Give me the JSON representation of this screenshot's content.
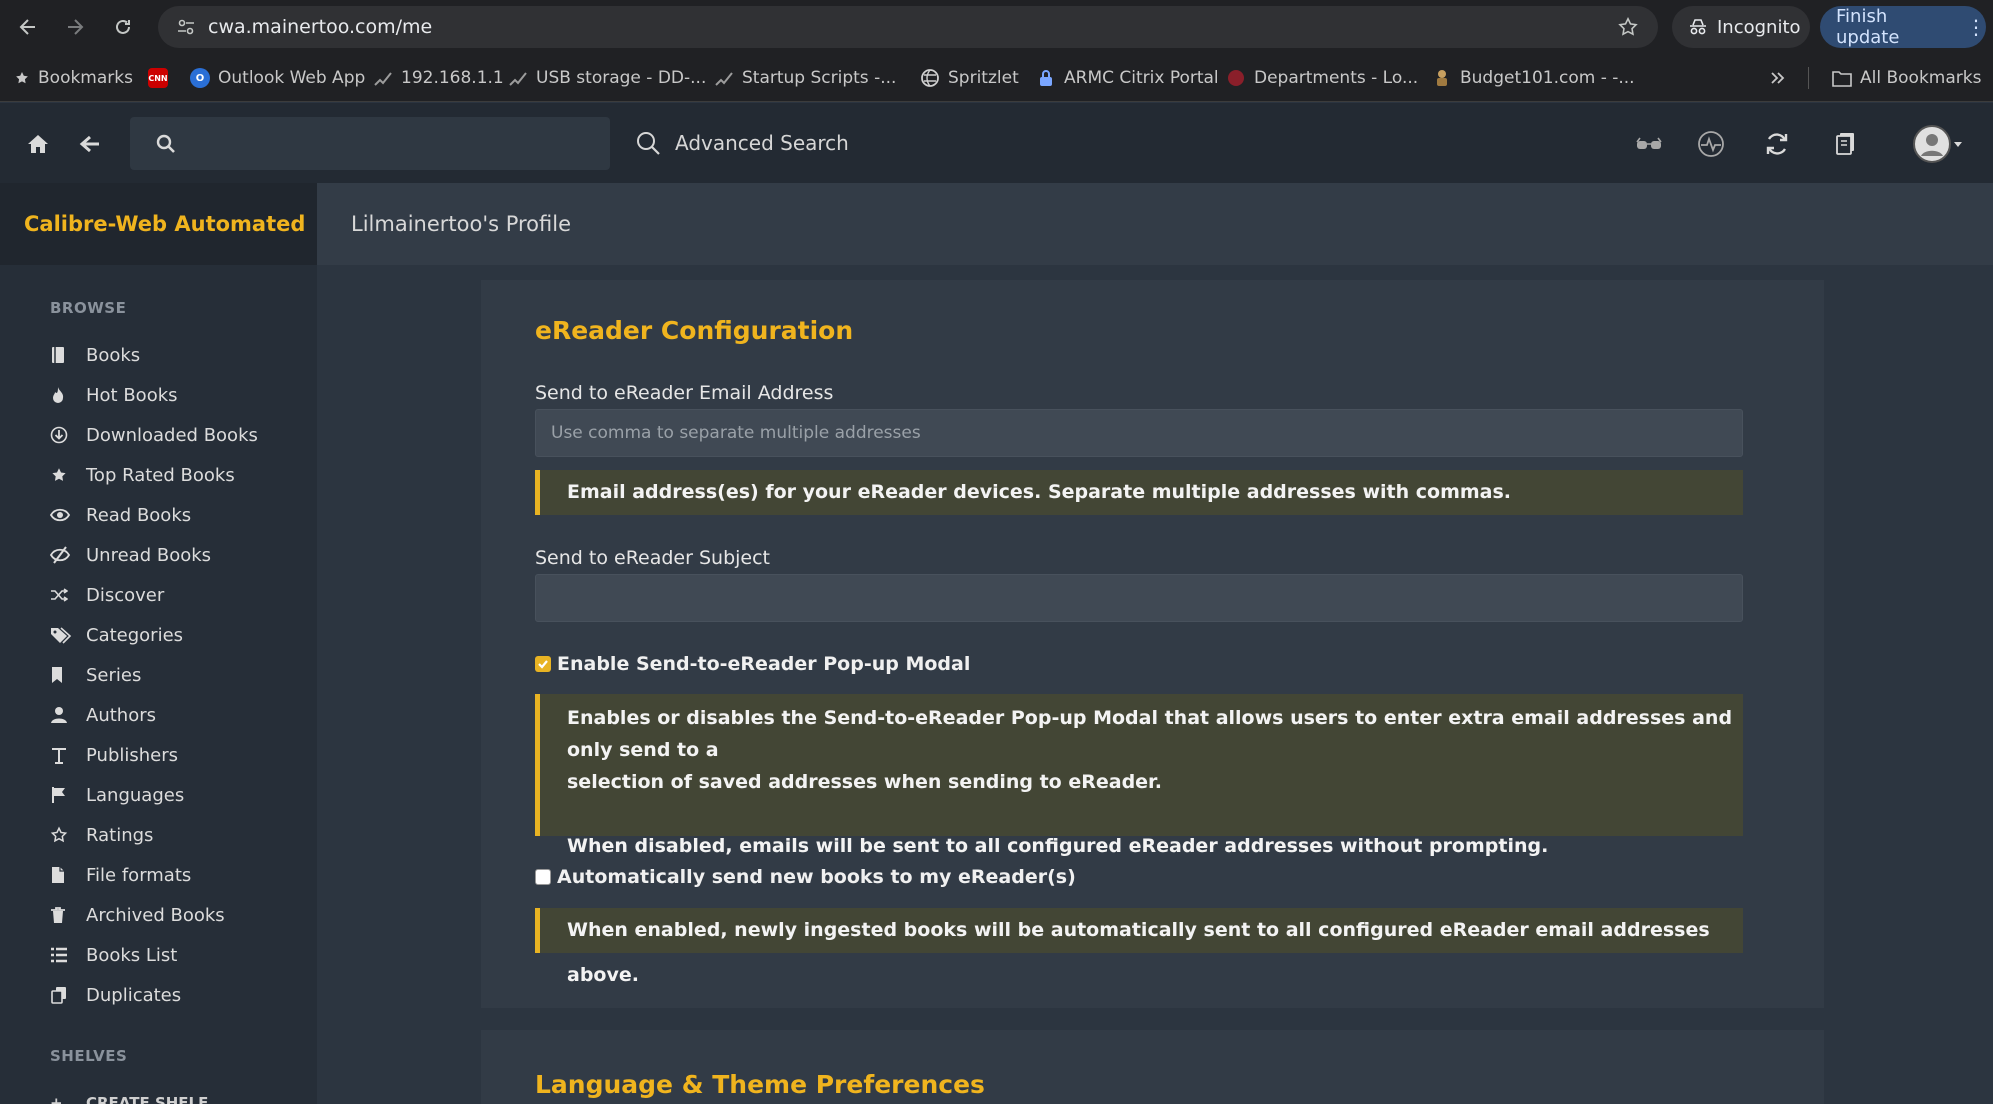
{
  "browser": {
    "url": "cwa.mainertoo.com/me",
    "incognito_label": "Incognito",
    "finish_update_label": "Finish update",
    "bookmarks": [
      {
        "label": "Bookmarks",
        "icon": "star-icon"
      },
      {
        "label": "Outlook Web App",
        "icon": "cnn-icon"
      },
      {
        "label": "192.168.1.1",
        "icon": "network-icon"
      },
      {
        "label": "USB storage - DD-...",
        "icon": "network-icon"
      },
      {
        "label": "Startup Scripts -...",
        "icon": "network-icon"
      },
      {
        "label": "Spritzlet",
        "icon": "globe-icon"
      },
      {
        "label": "ARMC Citrix Portal",
        "icon": "lock-icon"
      },
      {
        "label": "Departments - Lo...",
        "icon": "red-site-icon"
      },
      {
        "label": "Budget101.com - -...",
        "icon": "budget-icon"
      }
    ],
    "all_bookmarks_label": "All Bookmarks"
  },
  "appbar": {
    "search_placeholder": "",
    "advanced_search_label": "Advanced Search"
  },
  "sidebar": {
    "brand": "Calibre-Web Automated",
    "browse_title": "BROWSE",
    "items": [
      {
        "label": "Books",
        "icon": "book-icon"
      },
      {
        "label": "Hot Books",
        "icon": "fire-icon"
      },
      {
        "label": "Downloaded Books",
        "icon": "download-icon"
      },
      {
        "label": "Top Rated Books",
        "icon": "star-icon"
      },
      {
        "label": "Read Books",
        "icon": "eye-icon"
      },
      {
        "label": "Unread Books",
        "icon": "eye-slash-icon"
      },
      {
        "label": "Discover",
        "icon": "shuffle-icon"
      },
      {
        "label": "Categories",
        "icon": "tags-icon"
      },
      {
        "label": "Series",
        "icon": "bookmark-icon"
      },
      {
        "label": "Authors",
        "icon": "user-icon"
      },
      {
        "label": "Publishers",
        "icon": "text-icon"
      },
      {
        "label": "Languages",
        "icon": "flag-icon"
      },
      {
        "label": "Ratings",
        "icon": "star-outline-icon"
      },
      {
        "label": "File formats",
        "icon": "file-icon"
      },
      {
        "label": "Archived Books",
        "icon": "trash-icon"
      },
      {
        "label": "Books List",
        "icon": "list-icon"
      },
      {
        "label": "Duplicates",
        "icon": "duplicate-icon"
      }
    ],
    "shelves_title": "SHELVES",
    "create_shelf_label": "CREATE SHELF"
  },
  "main": {
    "page_title": "Lilmainertoo's Profile",
    "ereader_heading": "eReader Configuration",
    "email_label": "Send to eReader Email Address",
    "email_value": "",
    "email_placeholder": "Use comma to separate multiple addresses",
    "email_note": "Email address(es) for your eReader devices. Separate multiple addresses with commas.",
    "subject_label": "Send to eReader Subject",
    "subject_value": "",
    "popup_checkbox_label": "Enable Send-to-eReader Pop-up Modal",
    "popup_checked": true,
    "popup_note_line1": "Enables or disables the Send-to-eReader Pop-up Modal that allows users to enter extra email addresses and only send to a",
    "popup_note_line2": "selection of saved addresses when sending to eReader.",
    "popup_note_line3": "When disabled, emails will be sent to all configured eReader addresses without prompting.",
    "auto_send_label": "Automatically send new books to my eReader(s)",
    "auto_send_checked": false,
    "auto_send_note": "When enabled, newly ingested books will be automatically sent to all configured eReader email addresses above.",
    "language_heading": "Language & Theme Preferences"
  },
  "colors": {
    "accent": "#f0b41e",
    "note_border": "#e8b323",
    "finish_update_bg": "#2f4b72"
  }
}
